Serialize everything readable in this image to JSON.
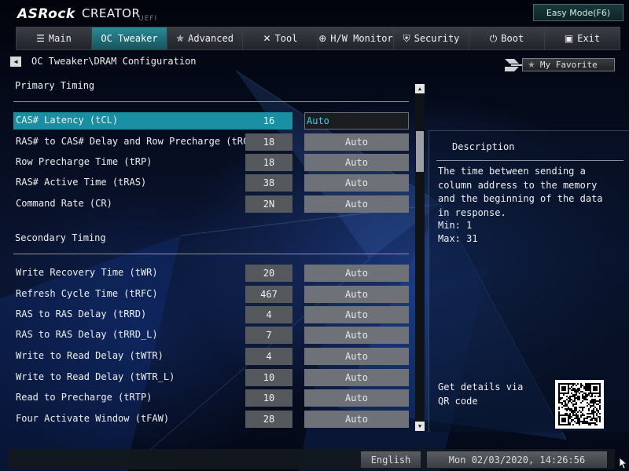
{
  "header": {
    "brand": "ASRock",
    "product": "CREATOR",
    "sub": "UEFI",
    "easy_mode_label": "Easy Mode(F6)"
  },
  "tabs": [
    {
      "label": "Main",
      "icon": "list-icon"
    },
    {
      "label": "OC Tweaker",
      "icon": ""
    },
    {
      "label": "Advanced",
      "icon": "star-icon"
    },
    {
      "label": "Tool",
      "icon": "tools-icon"
    },
    {
      "label": "H/W Monitor",
      "icon": "monitor-icon"
    },
    {
      "label": "Security",
      "icon": "shield-icon"
    },
    {
      "label": "Boot",
      "icon": "power-icon"
    },
    {
      "label": "Exit",
      "icon": "exit-icon"
    }
  ],
  "active_tab": "OC Tweaker",
  "breadcrumb": "OC Tweaker\\DRAM Configuration",
  "favorite_label": "My Favorite",
  "sections": {
    "primary": "Primary Timing",
    "secondary": "Secondary Timing"
  },
  "primary_rows": [
    {
      "label": "CAS# Latency (tCL)",
      "value": "16",
      "setting": "Auto"
    },
    {
      "label": "RAS# to CAS# Delay and Row Precharge (tRCDtRP)",
      "value": "18",
      "setting": "Auto"
    },
    {
      "label": "Row Precharge Time (tRP)",
      "value": "18",
      "setting": "Auto"
    },
    {
      "label": "RAS# Active Time (tRAS)",
      "value": "38",
      "setting": "Auto"
    },
    {
      "label": "Command Rate (CR)",
      "value": "2N",
      "setting": "Auto"
    }
  ],
  "secondary_rows": [
    {
      "label": "Write Recovery Time (tWR)",
      "value": "20",
      "setting": "Auto"
    },
    {
      "label": "Refresh Cycle Time (tRFC)",
      "value": "467",
      "setting": "Auto"
    },
    {
      "label": "RAS to RAS Delay (tRRD)",
      "value": "4",
      "setting": "Auto"
    },
    {
      "label": "RAS to RAS Delay (tRRD_L)",
      "value": "7",
      "setting": "Auto"
    },
    {
      "label": "Write to Read Delay (tWTR)",
      "value": "4",
      "setting": "Auto"
    },
    {
      "label": "Write to Read Delay (tWTR_L)",
      "value": "10",
      "setting": "Auto"
    },
    {
      "label": "Read to Precharge (tRTP)",
      "value": "10",
      "setting": "Auto"
    },
    {
      "label": "Four Activate Window (tFAW)",
      "value": "28",
      "setting": "Auto"
    }
  ],
  "description": {
    "title": "Description",
    "text": "The time between sending a column address to the memory and the beginning of the data in response.",
    "min": "Min: 1",
    "max": "Max: 31",
    "qr_text": "Get details via QR code"
  },
  "footer": {
    "language": "English",
    "datetime": "Mon 02/03/2020, 14:26:56"
  },
  "colors": {
    "accent": "#1a8fa3",
    "value_box": "#55585d",
    "dropdown": "#6e7177"
  }
}
